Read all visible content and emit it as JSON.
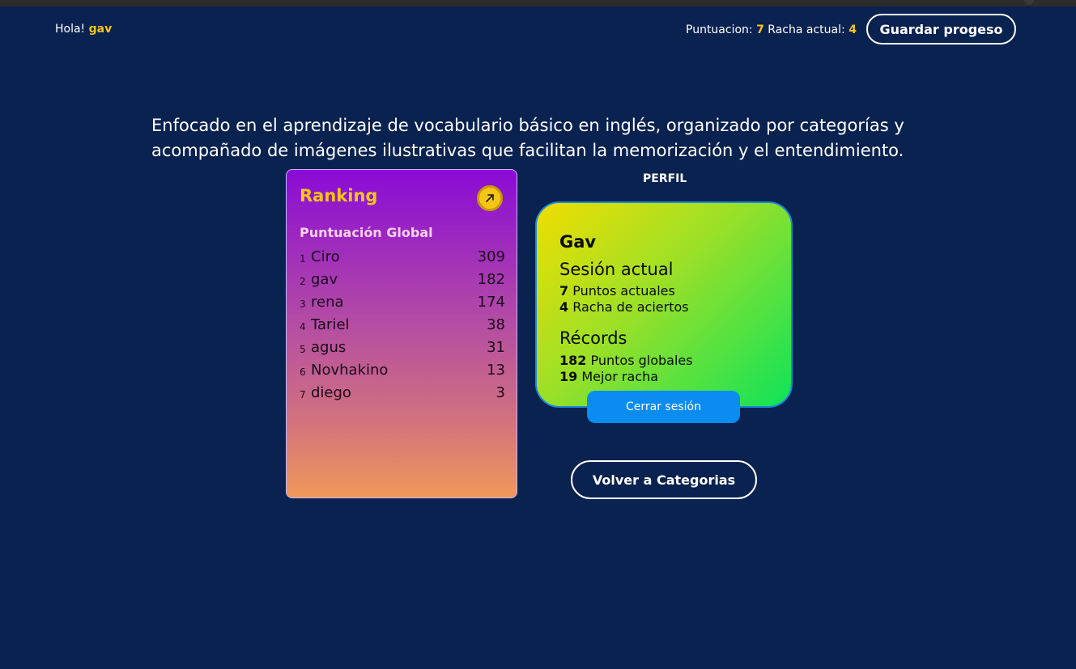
{
  "header": {
    "greeting_label": "Hola!",
    "username": "gav",
    "score_label": "Puntuacion:",
    "score_value": "7",
    "streak_label": "Racha actual:",
    "streak_value": "4",
    "save_button": "Guardar progeso"
  },
  "intro_text": "Enfocado en el aprendizaje de vocabulario básico en inglés, organizado por categorías y acompañado de imágenes ilustrativas que facilitan la memorización y el entendimiento.",
  "ranking": {
    "title": "Ranking",
    "open_icon": "arrow-up-right-icon",
    "subtitle": "Puntuación Global",
    "entries": [
      {
        "pos": "1",
        "name": "Ciro",
        "score": "309"
      },
      {
        "pos": "2",
        "name": "gav",
        "score": "182"
      },
      {
        "pos": "3",
        "name": "rena",
        "score": "174"
      },
      {
        "pos": "4",
        "name": "Tariel",
        "score": "38"
      },
      {
        "pos": "5",
        "name": "agus",
        "score": "31"
      },
      {
        "pos": "6",
        "name": "Novhakino",
        "score": "13"
      },
      {
        "pos": "7",
        "name": "diego",
        "score": "3"
      }
    ]
  },
  "profile": {
    "label": "PERFIL",
    "name": "Gav",
    "current_session_title": "Sesión actual",
    "current_points_value": "7",
    "current_points_label": "Puntos actuales",
    "current_streak_value": "4",
    "current_streak_label": "Racha de aciertos",
    "records_title": "Récords",
    "global_points_value": "182",
    "global_points_label": "Puntos globales",
    "best_streak_value": "19",
    "best_streak_label": "Mejor racha",
    "logout_button": "Cerrar sesión"
  },
  "back_button": "Volver a Categorias",
  "colors": {
    "background": "#0a2250",
    "accent": "#f5c518",
    "logout": "#0a8cf0"
  }
}
